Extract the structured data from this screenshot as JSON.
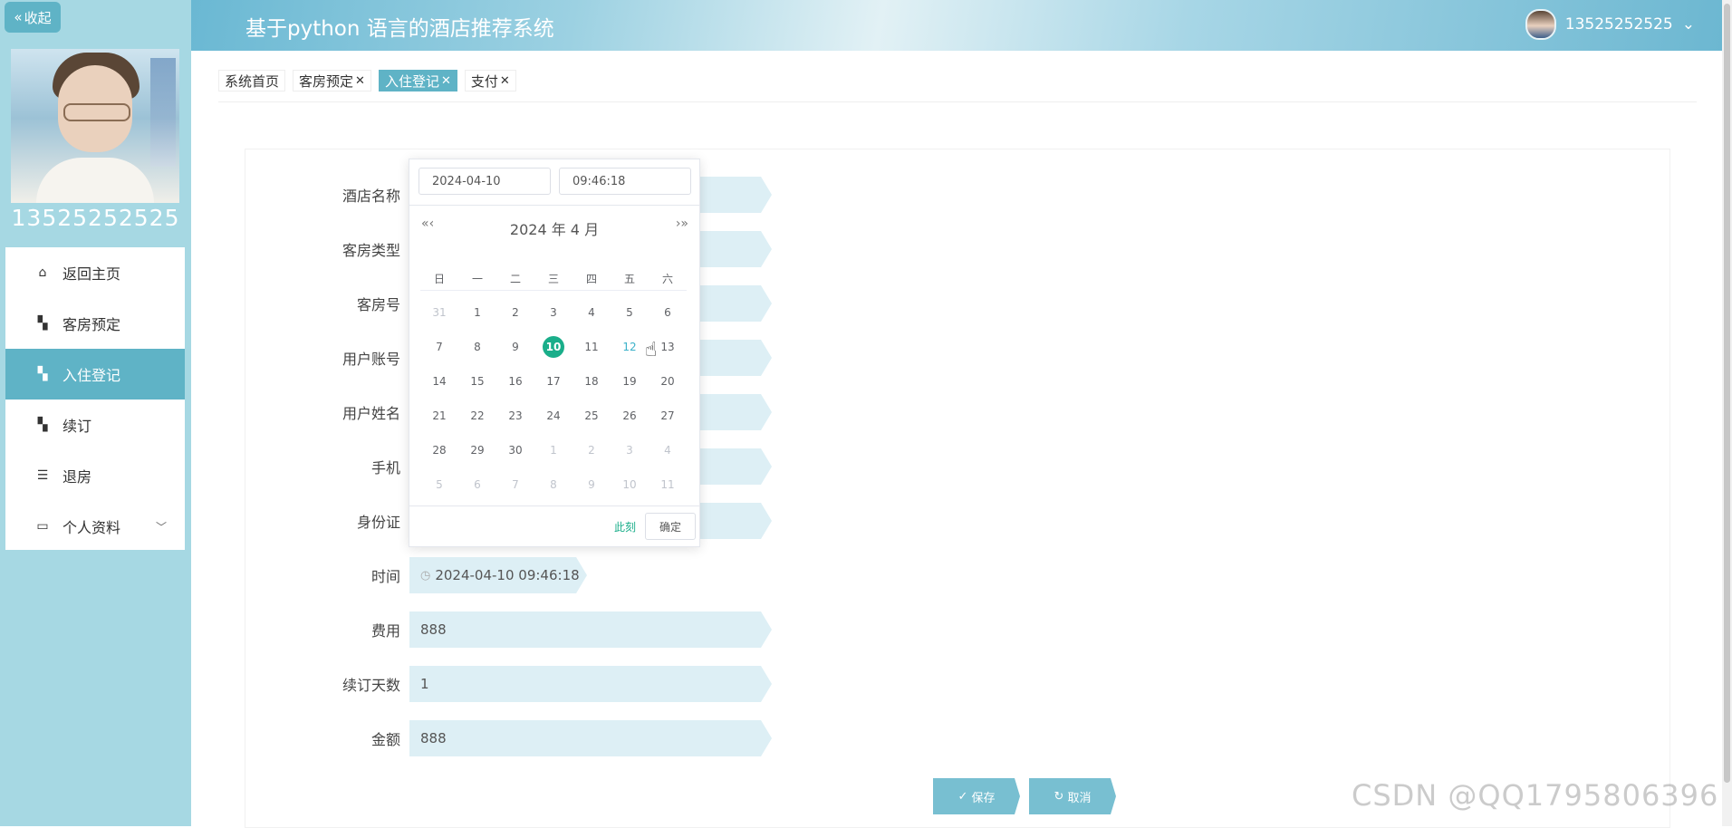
{
  "sidebar": {
    "collapse_label": "收起",
    "username": "13525252525",
    "items": [
      {
        "label": "返回主页",
        "icon": "home-icon"
      },
      {
        "label": "客房预定",
        "icon": "grid-icon"
      },
      {
        "label": "入住登记",
        "icon": "grid-icon"
      },
      {
        "label": "续订",
        "icon": "grid-icon"
      },
      {
        "label": "退房",
        "icon": "sliders-icon"
      },
      {
        "label": "个人资料",
        "icon": "card-icon"
      }
    ]
  },
  "header": {
    "title": "基于python 语言的酒店推荐系统",
    "username": "13525252525"
  },
  "tabs": [
    {
      "label": "系统首页"
    },
    {
      "label": "客房预定"
    },
    {
      "label": "入住登记"
    },
    {
      "label": "支付"
    }
  ],
  "form": {
    "fields": [
      {
        "label": "酒店名称",
        "value": ""
      },
      {
        "label": "客房类型",
        "value": ""
      },
      {
        "label": "客房号",
        "value": ""
      },
      {
        "label": "用户账号",
        "value": ""
      },
      {
        "label": "用户姓名",
        "value": ""
      },
      {
        "label": "手机",
        "value": ""
      },
      {
        "label": "身份证",
        "value": ""
      },
      {
        "label": "时间",
        "value": "2024-04-10 09:46:18"
      },
      {
        "label": "费用",
        "value": "888"
      },
      {
        "label": "续订天数",
        "value": "1"
      },
      {
        "label": "金额",
        "value": "888"
      }
    ],
    "save_label": "保存",
    "cancel_label": "取消"
  },
  "datepicker": {
    "date_input": "2024-04-10",
    "time_input": "09:46:18",
    "month_label": "2024 年  4 月",
    "weekdays": [
      "日",
      "一",
      "二",
      "三",
      "四",
      "五",
      "六"
    ],
    "weeks": [
      [
        "31",
        "1",
        "2",
        "3",
        "4",
        "5",
        "6"
      ],
      [
        "7",
        "8",
        "9",
        "10",
        "11",
        "12",
        "13"
      ],
      [
        "14",
        "15",
        "16",
        "17",
        "18",
        "19",
        "20"
      ],
      [
        "21",
        "22",
        "23",
        "24",
        "25",
        "26",
        "27"
      ],
      [
        "28",
        "29",
        "30",
        "1",
        "2",
        "3",
        "4"
      ],
      [
        "5",
        "6",
        "7",
        "8",
        "9",
        "10",
        "11"
      ]
    ],
    "now_label": "此刻",
    "ok_label": "确定"
  },
  "watermark": "CSDN @QQ1795806396",
  "colors": {
    "accent": "#5fb3c6",
    "today": "#1aae8a",
    "field_bg": "#ddeff5",
    "sidebar_bg": "#a6d8e3"
  }
}
